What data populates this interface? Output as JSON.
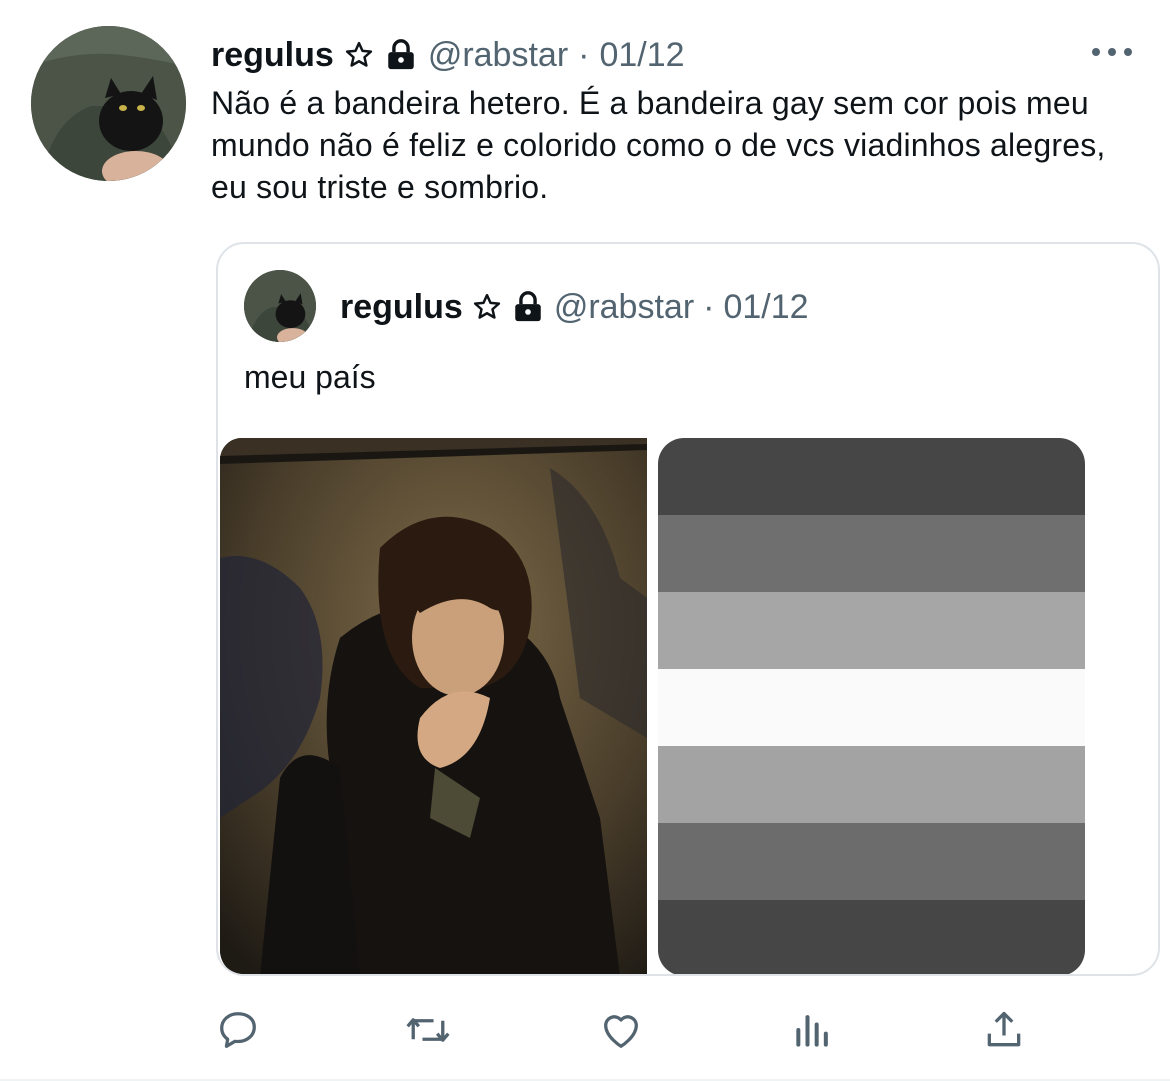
{
  "tweet": {
    "display_name": "regulus",
    "handle": "@rabstar",
    "separator": "·",
    "date": "01/12",
    "text": "Não é a bandeira hetero. É a bandeira gay sem cor pois meu mundo não é feliz e colorido como o de vcs viadinhos alegres, eu sou triste e sombrio.",
    "icons": [
      "star-icon",
      "lock-icon",
      "more-icon"
    ]
  },
  "quoted_tweet": {
    "display_name": "regulus",
    "handle": "@rabstar",
    "separator": "·",
    "date": "01/12",
    "text": "meu país",
    "icons": [
      "star-icon",
      "lock-icon"
    ],
    "media": {
      "photo": "person-lighting-cigarette-photo",
      "flag_stripes": [
        "#464646",
        "#6f6f6f",
        "#a6a6a6",
        "#fafafa",
        "#a3a3a3",
        "#6c6c6c",
        "#464646"
      ]
    }
  },
  "actions": [
    "reply-icon",
    "retweet-icon",
    "like-icon",
    "analytics-icon",
    "share-icon"
  ],
  "colors": {
    "text": "#0f1419",
    "secondary": "#536471",
    "border": "#dfe3e7"
  }
}
